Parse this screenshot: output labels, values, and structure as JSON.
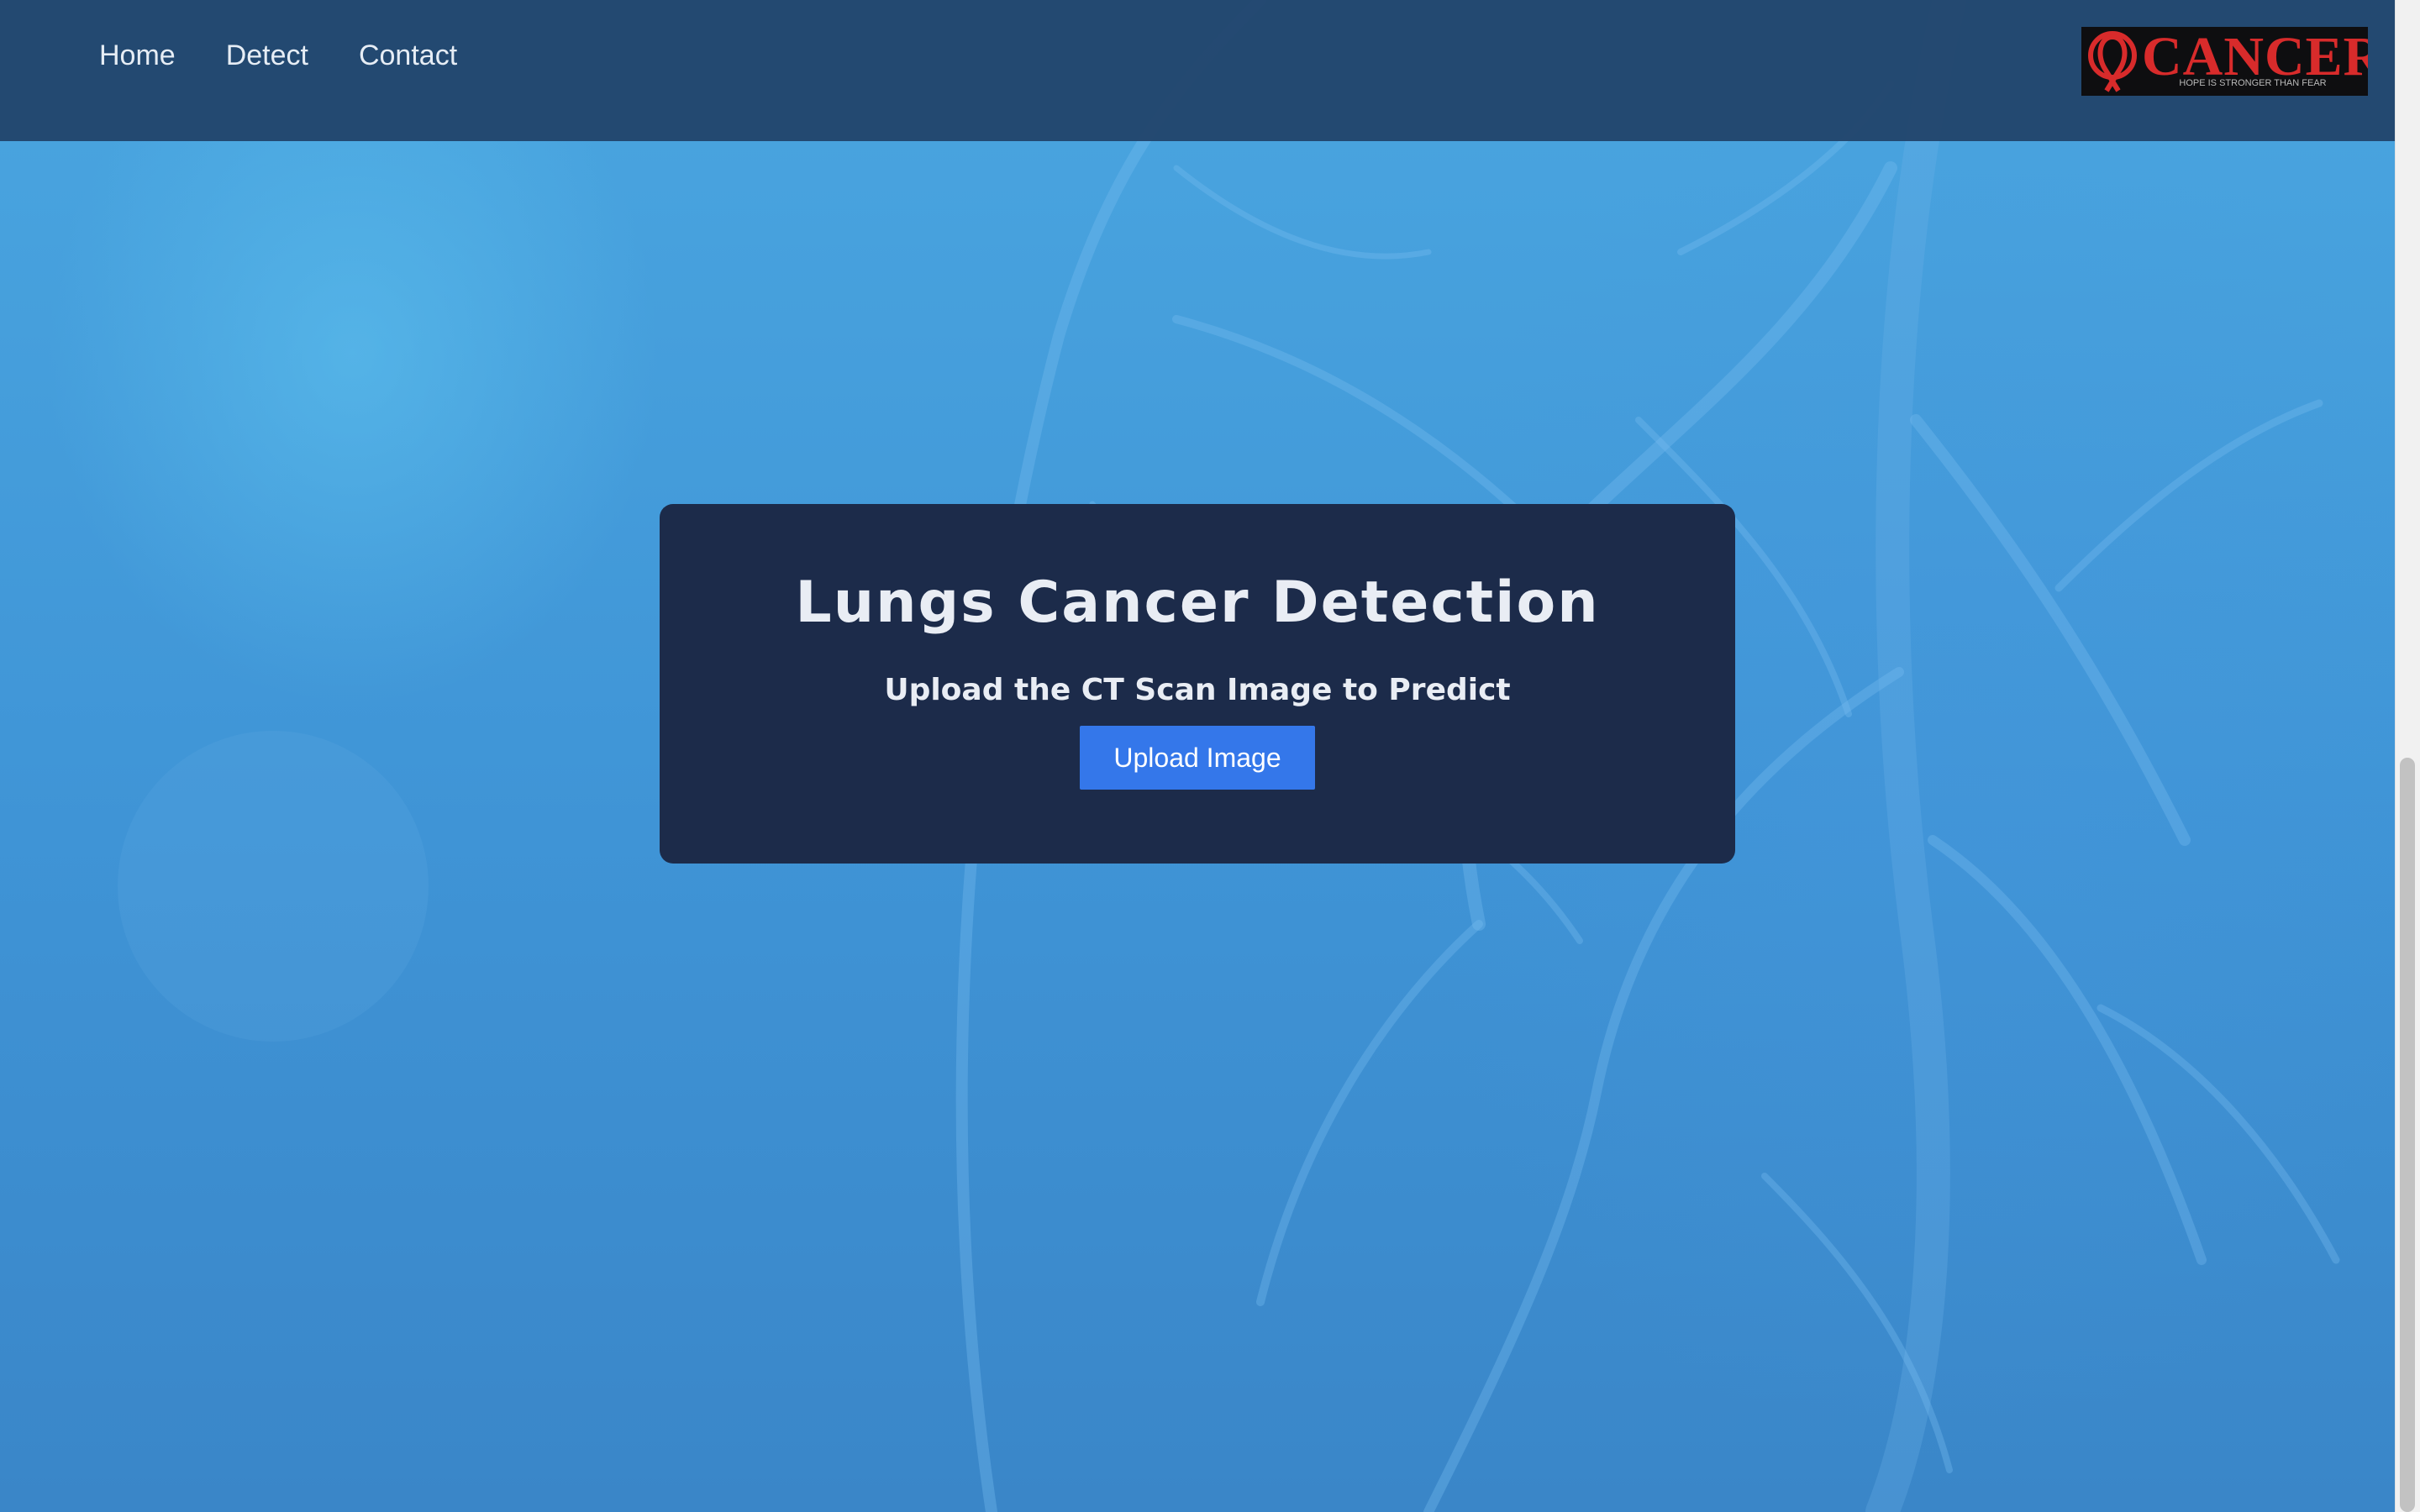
{
  "nav": {
    "items": [
      {
        "label": "Home"
      },
      {
        "label": "Detect"
      },
      {
        "label": "Contact"
      }
    ]
  },
  "logo": {
    "brand": "CANCER",
    "tagline": "HOPE IS STRONGER THAN FEAR"
  },
  "main": {
    "title": "Lungs Cancer Detection",
    "subtitle": "Upload the CT Scan Image to Predict",
    "upload_label": "Upload Image"
  },
  "colors": {
    "navbar": "#204268",
    "card": "#1c2b4a",
    "button": "#3477ea",
    "logo_red": "#d82b2b",
    "background": "#4aa6e0"
  },
  "icons": {
    "logo_mark": "awareness-ribbon-icon"
  }
}
